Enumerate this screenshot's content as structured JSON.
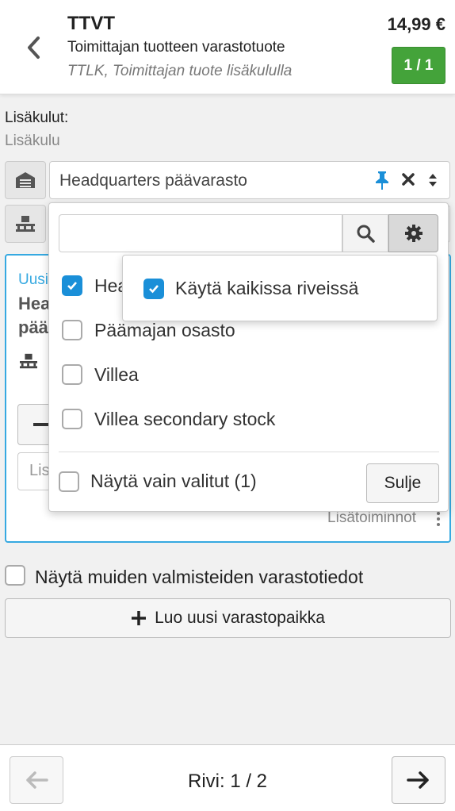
{
  "header": {
    "title": "TTVT",
    "subtitle": "Toimittajan tuotteen varastotuote",
    "subtitle2": "TTLK, Toimittajan tuote lisäkululla",
    "price": "14,99 €",
    "badge": "1 / 1",
    "badge_color": "#44a33a"
  },
  "extras": {
    "label": "Lisäkulut:",
    "value": "Lisäkulu"
  },
  "warehouse": {
    "selected": "Headquarters päävarasto",
    "icons": [
      "warehouse-icon",
      "pin-icon",
      "close-icon",
      "sort-icon"
    ]
  },
  "card": {
    "tag": "Uusi",
    "title_line1": "Hea",
    "title_line2": "pää",
    "input_placeholder": "Lis",
    "more_label": "Lisätoiminnot",
    "accent": "#36a9e1"
  },
  "dropdown": {
    "search_value": "",
    "items": [
      {
        "label": "Headquarters päävarasto",
        "checked": true
      },
      {
        "label": "Päämajan osasto",
        "checked": false
      },
      {
        "label": "Villea",
        "checked": false
      },
      {
        "label": "Villea secondary stock",
        "checked": false
      }
    ],
    "item0_visible": "Hea",
    "show_selected_label": "Näytä vain valitut (1)",
    "close_label": "Sulje"
  },
  "popover": {
    "label": "Käytä kaikissa riveissä",
    "checked": true
  },
  "main": {
    "show_other_label": "Näytä muiden valmisteiden varastotiedot",
    "new_location_label": "Luo uusi varastopaikka"
  },
  "footer": {
    "row_label": "Rivi: 1 / 2"
  }
}
